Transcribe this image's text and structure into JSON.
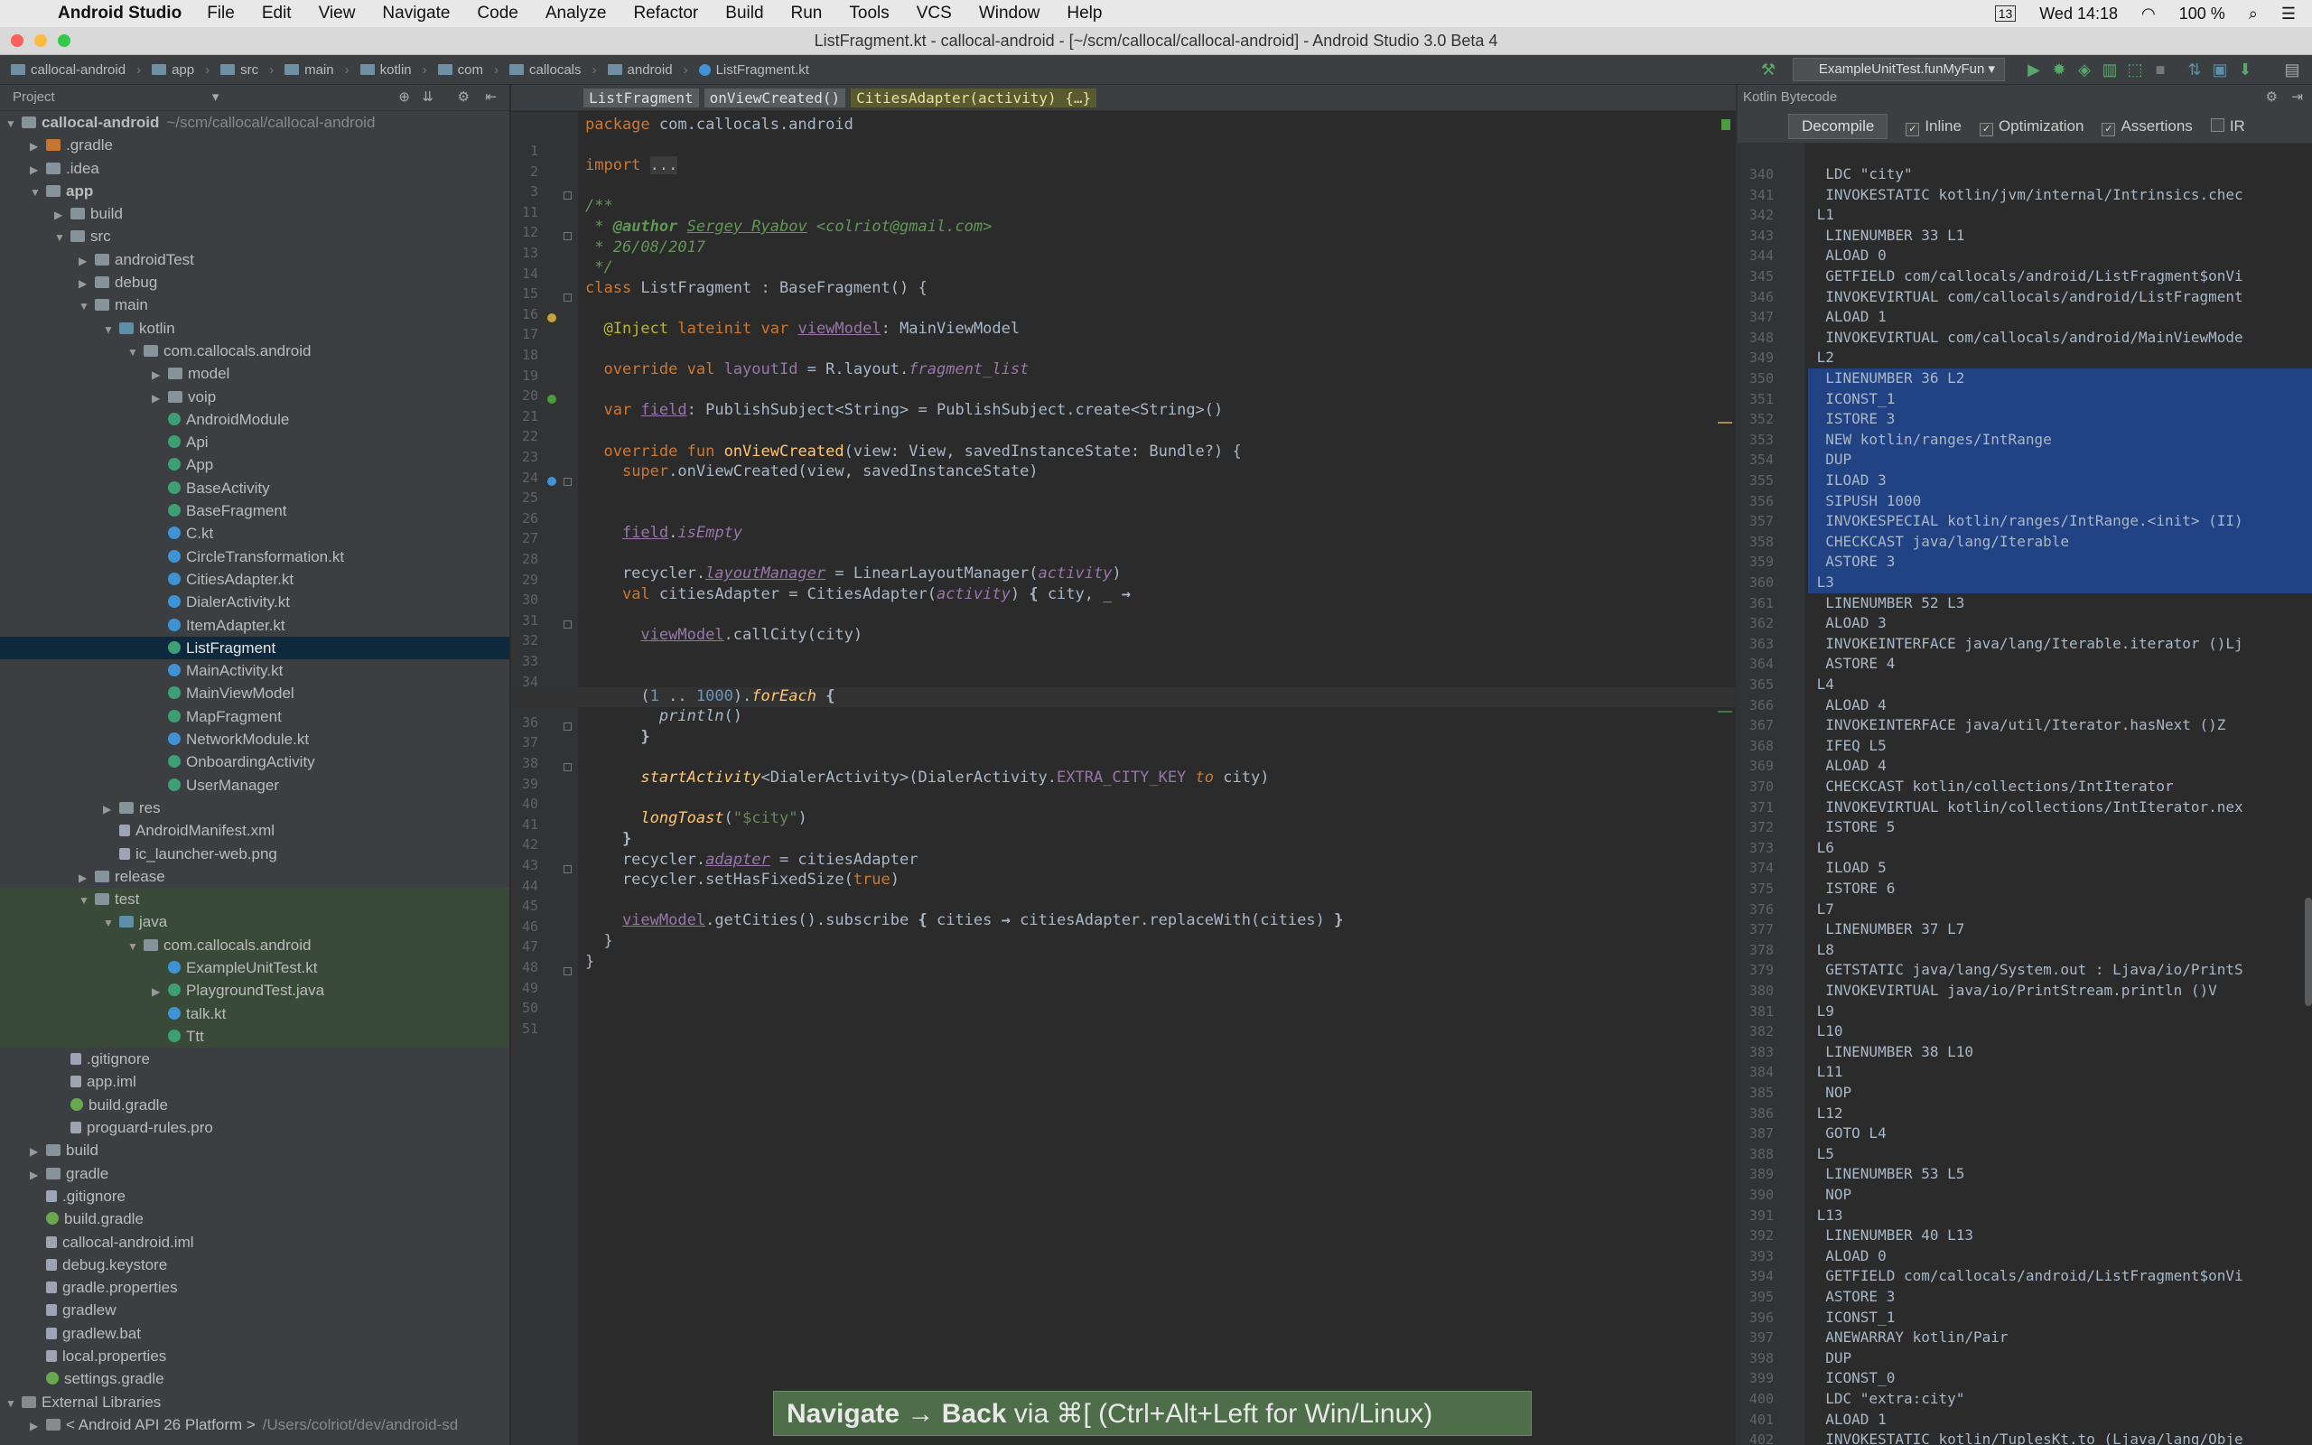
{
  "menubar": {
    "app": "Android Studio",
    "items": [
      "File",
      "Edit",
      "View",
      "Navigate",
      "Code",
      "Analyze",
      "Refactor",
      "Build",
      "Run",
      "Tools",
      "VCS",
      "Window",
      "Help"
    ],
    "status": {
      "date_time": "Wed 14:18",
      "battery": "100 %",
      "badge": "13"
    }
  },
  "window": {
    "title": "ListFragment.kt - callocal-android - [~/scm/callocal/callocal-android] - Android Studio 3.0 Beta 4"
  },
  "navbar": {
    "breadcrumbs": [
      "callocal-android",
      "app",
      "src",
      "main",
      "kotlin",
      "com",
      "callocals",
      "android",
      "ListFragment.kt"
    ],
    "run_config": "ExampleUnitTest.funMyFun"
  },
  "project": {
    "header": "Project",
    "tree": [
      {
        "label": "callocal-android",
        "suffix": "~/scm/callocal/callocal-android",
        "depth": 0,
        "open": true,
        "icon": "folder",
        "bold": true
      },
      {
        "label": ".gradle",
        "depth": 1,
        "open": false,
        "icon": "excl"
      },
      {
        "label": ".idea",
        "depth": 1,
        "open": false,
        "icon": "folder"
      },
      {
        "label": "app",
        "depth": 1,
        "open": true,
        "icon": "folder",
        "bold": true
      },
      {
        "label": "build",
        "depth": 2,
        "open": false,
        "icon": "folder"
      },
      {
        "label": "src",
        "depth": 2,
        "open": true,
        "icon": "folder"
      },
      {
        "label": "androidTest",
        "depth": 3,
        "open": false,
        "icon": "folder"
      },
      {
        "label": "debug",
        "depth": 3,
        "open": false,
        "icon": "folder"
      },
      {
        "label": "main",
        "depth": 3,
        "open": true,
        "icon": "folder"
      },
      {
        "label": "kotlin",
        "depth": 4,
        "open": true,
        "icon": "src"
      },
      {
        "label": "com.callocals.android",
        "depth": 5,
        "open": true,
        "icon": "folder"
      },
      {
        "label": "model",
        "depth": 6,
        "open": false,
        "icon": "folder"
      },
      {
        "label": "voip",
        "depth": 6,
        "open": false,
        "icon": "folder"
      },
      {
        "label": "AndroidModule",
        "depth": 6,
        "icon": "cls"
      },
      {
        "label": "Api",
        "depth": 6,
        "icon": "cls"
      },
      {
        "label": "App",
        "depth": 6,
        "icon": "cls"
      },
      {
        "label": "BaseActivity",
        "depth": 6,
        "icon": "cls"
      },
      {
        "label": "BaseFragment",
        "depth": 6,
        "icon": "cls"
      },
      {
        "label": "C.kt",
        "depth": 6,
        "icon": "kt"
      },
      {
        "label": "CircleTransformation.kt",
        "depth": 6,
        "icon": "kt"
      },
      {
        "label": "CitiesAdapter.kt",
        "depth": 6,
        "icon": "kt"
      },
      {
        "label": "DialerActivity.kt",
        "depth": 6,
        "icon": "kt"
      },
      {
        "label": "ItemAdapter.kt",
        "depth": 6,
        "icon": "kt"
      },
      {
        "label": "ListFragment",
        "depth": 6,
        "icon": "cls",
        "selected": true
      },
      {
        "label": "MainActivity.kt",
        "depth": 6,
        "icon": "kt"
      },
      {
        "label": "MainViewModel",
        "depth": 6,
        "icon": "cls"
      },
      {
        "label": "MapFragment",
        "depth": 6,
        "icon": "cls"
      },
      {
        "label": "NetworkModule.kt",
        "depth": 6,
        "icon": "kt"
      },
      {
        "label": "OnboardingActivity",
        "depth": 6,
        "icon": "cls"
      },
      {
        "label": "UserManager",
        "depth": 6,
        "icon": "cls"
      },
      {
        "label": "res",
        "depth": 4,
        "open": false,
        "icon": "folder"
      },
      {
        "label": "AndroidManifest.xml",
        "depth": 4,
        "icon": "file"
      },
      {
        "label": "ic_launcher-web.png",
        "depth": 4,
        "icon": "file"
      },
      {
        "label": "release",
        "depth": 3,
        "open": false,
        "icon": "folder"
      },
      {
        "label": "test",
        "depth": 3,
        "open": true,
        "icon": "folder",
        "green": true
      },
      {
        "label": "java",
        "depth": 4,
        "open": true,
        "icon": "src",
        "green": true
      },
      {
        "label": "com.callocals.android",
        "depth": 5,
        "open": true,
        "icon": "folder",
        "green": true
      },
      {
        "label": "ExampleUnitTest.kt",
        "depth": 6,
        "icon": "kt",
        "green": true
      },
      {
        "label": "PlaygroundTest.java",
        "depth": 6,
        "open": false,
        "icon": "cls",
        "green": true
      },
      {
        "label": "talk.kt",
        "depth": 6,
        "icon": "kt",
        "green": true
      },
      {
        "label": "Ttt",
        "depth": 6,
        "icon": "cls",
        "green": true
      },
      {
        "label": ".gitignore",
        "depth": 2,
        "icon": "file"
      },
      {
        "label": "app.iml",
        "depth": 2,
        "icon": "file"
      },
      {
        "label": "build.gradle",
        "depth": 2,
        "icon": "gradle"
      },
      {
        "label": "proguard-rules.pro",
        "depth": 2,
        "icon": "file"
      },
      {
        "label": "build",
        "depth": 1,
        "open": false,
        "icon": "folder"
      },
      {
        "label": "gradle",
        "depth": 1,
        "open": false,
        "icon": "folder"
      },
      {
        "label": ".gitignore",
        "depth": 1,
        "icon": "file"
      },
      {
        "label": "build.gradle",
        "depth": 1,
        "icon": "gradle"
      },
      {
        "label": "callocal-android.iml",
        "depth": 1,
        "icon": "file"
      },
      {
        "label": "debug.keystore",
        "depth": 1,
        "icon": "file"
      },
      {
        "label": "gradle.properties",
        "depth": 1,
        "icon": "file"
      },
      {
        "label": "gradlew",
        "depth": 1,
        "icon": "file"
      },
      {
        "label": "gradlew.bat",
        "depth": 1,
        "icon": "file"
      },
      {
        "label": "local.properties",
        "depth": 1,
        "icon": "file"
      },
      {
        "label": "settings.gradle",
        "depth": 1,
        "icon": "gradle"
      },
      {
        "label": "External Libraries",
        "depth": 0,
        "open": true,
        "icon": "lib"
      },
      {
        "label": "< Android API 26 Platform >",
        "suffix": "/Users/colriot/dev/android-sd",
        "depth": 1,
        "open": false,
        "icon": "lib"
      }
    ]
  },
  "editor": {
    "breadcrumbs": [
      "ListFragment",
      "onViewCreated()",
      "CitiesAdapter(activity) {…}"
    ],
    "lines": [
      {
        "n": "1",
        "html": "<span class=\"kw\">package</span> com.callocals.android"
      },
      {
        "n": "2",
        "html": ""
      },
      {
        "n": "3",
        "html": "<span class=\"kw\">import</span> <span style=\"background:#3b3b3b\">...</span>"
      },
      {
        "n": "11",
        "html": ""
      },
      {
        "n": "12",
        "html": "<span class=\"cm\">/**</span>"
      },
      {
        "n": "13",
        "html": "<span class=\"cm\"> * <b>@author</b> <u>Sergey Ryabov</u> &lt;colriot@gmail.com&gt;</span>"
      },
      {
        "n": "14",
        "html": "<span class=\"cm\"> * 26/08/2017</span>"
      },
      {
        "n": "15",
        "html": "<span class=\"cm\"> */</span>"
      },
      {
        "n": "16",
        "html": "<span class=\"kw\">class</span> ListFragment : BaseFragment() {"
      },
      {
        "n": "17",
        "html": ""
      },
      {
        "n": "18",
        "html": "  <span class=\"ann\">@Inject</span> <span class=\"kw\">lateinit var</span> <span class=\"prop ul\">viewModel</span>: MainViewModel"
      },
      {
        "n": "19",
        "html": ""
      },
      {
        "n": "20",
        "html": "  <span class=\"kw\">override val</span> <span class=\"prop\">layoutId</span> = R.layout.<span class=\"prop ital\">fragment_list</span>"
      },
      {
        "n": "21",
        "html": ""
      },
      {
        "n": "22",
        "html": "  <span class=\"kw\">var</span> <span class=\"prop ul\">field</span>: PublishSubject&lt;String&gt; = PublishSubject.create&lt;String&gt;()"
      },
      {
        "n": "23",
        "html": ""
      },
      {
        "n": "24",
        "html": "  <span class=\"kw\">override fun</span> <span class=\"fn\">onViewCreated</span>(view: View, savedInstanceState: Bundle?) {"
      },
      {
        "n": "25",
        "html": "    <span class=\"kw\">super</span>.onViewCreated(view, savedInstanceState)"
      },
      {
        "n": "26",
        "html": ""
      },
      {
        "n": "27",
        "html": ""
      },
      {
        "n": "28",
        "html": "    <span class=\"prop ul\">field</span>.<span class=\"prop ital\">isEmpty</span>"
      },
      {
        "n": "29",
        "html": ""
      },
      {
        "n": "30",
        "html": "    recycler.<span class=\"prop ital ul\">layoutManager</span> = LinearLayoutManager(<span class=\"prop ital\">activity</span>)"
      },
      {
        "n": "31",
        "html": "    <span class=\"kw\">val</span> citiesAdapter = CitiesAdapter(<span class=\"prop ital\">activity</span>) <b>{</b> city, _ <b>→</b>"
      },
      {
        "n": "32",
        "html": ""
      },
      {
        "n": "33",
        "html": "      <span class=\"prop ul\">viewModel</span>.callCity(city)"
      },
      {
        "n": "34",
        "html": ""
      },
      {
        "n": "35",
        "html": ""
      },
      {
        "n": "36",
        "html": "      (<span class=\"num\">1</span> .. <span class=\"num\">1000</span>).<span class=\"fn ital\">forEach</span> <b>{</b>"
      },
      {
        "n": "37",
        "html": "        <span class=\"ital\">println</span>()"
      },
      {
        "n": "38",
        "html": "      <b>}</b>"
      },
      {
        "n": "39",
        "html": ""
      },
      {
        "n": "40",
        "html": "      <span class=\"fn ital\">startActivity</span>&lt;DialerActivity&gt;(DialerActivity.<span class=\"prop\">EXTRA_CITY_KEY</span> <span class=\"kw ital\">to</span> city)"
      },
      {
        "n": "41",
        "html": ""
      },
      {
        "n": "42",
        "html": "      <span class=\"fn ital\">longToast</span>(<span class=\"str\">\"$city\"</span>)"
      },
      {
        "n": "43",
        "html": "    <b>}</b>"
      },
      {
        "n": "44",
        "html": "    recycler.<span class=\"prop ital ul\">adapter</span> = citiesAdapter"
      },
      {
        "n": "45",
        "html": "    recycler.setHasFixedSize(<span class=\"kw\">true</span>)"
      },
      {
        "n": "46",
        "html": ""
      },
      {
        "n": "47",
        "html": "    <span class=\"prop ul\">viewModel</span>.getCities().subscribe <b>{</b> cities <b>→</b> citiesAdapter.replaceWith(cities) <b>}</b>"
      },
      {
        "n": "48",
        "html": "  }"
      },
      {
        "n": "49",
        "html": "}"
      },
      {
        "n": "50",
        "html": ""
      },
      {
        "n": "51",
        "html": ""
      }
    ]
  },
  "bytecode": {
    "header": "Kotlin Bytecode",
    "decompile": "Decompile",
    "options": [
      {
        "label": "Inline",
        "checked": true
      },
      {
        "label": "Optimization",
        "checked": true
      },
      {
        "label": "Assertions",
        "checked": true
      },
      {
        "label": "IR",
        "checked": false
      }
    ],
    "lines": [
      {
        "n": "340",
        "t": "  LDC \"city\""
      },
      {
        "n": "341",
        "t": "  INVOKESTATIC kotlin/jvm/internal/Intrinsics.chec"
      },
      {
        "n": "342",
        "t": " L1"
      },
      {
        "n": "343",
        "t": "  LINENUMBER 33 L1"
      },
      {
        "n": "344",
        "t": "  ALOAD 0"
      },
      {
        "n": "345",
        "t": "  GETFIELD com/callocals/android/ListFragment$onVi"
      },
      {
        "n": "346",
        "t": "  INVOKEVIRTUAL com/callocals/android/ListFragment"
      },
      {
        "n": "347",
        "t": "  ALOAD 1"
      },
      {
        "n": "348",
        "t": "  INVOKEVIRTUAL com/callocals/android/MainViewMode"
      },
      {
        "n": "349",
        "t": " L2"
      },
      {
        "n": "350",
        "t": "  LINENUMBER 36 L2",
        "hl": true
      },
      {
        "n": "351",
        "t": "  ICONST_1",
        "hl": true
      },
      {
        "n": "352",
        "t": "  ISTORE 3",
        "hl": true
      },
      {
        "n": "353",
        "t": "  NEW kotlin/ranges/IntRange",
        "hl": true
      },
      {
        "n": "354",
        "t": "  DUP",
        "hl": true
      },
      {
        "n": "355",
        "t": "  ILOAD 3",
        "hl": true
      },
      {
        "n": "356",
        "t": "  SIPUSH 1000",
        "hl": true
      },
      {
        "n": "357",
        "t": "  INVOKESPECIAL kotlin/ranges/IntRange.<init> (II)",
        "hl": true
      },
      {
        "n": "358",
        "t": "  CHECKCAST java/lang/Iterable",
        "hl": true
      },
      {
        "n": "359",
        "t": "  ASTORE 3",
        "hl": true
      },
      {
        "n": "360",
        "t": " L3",
        "hl": true
      },
      {
        "n": "361",
        "t": "  LINENUMBER 52 L3"
      },
      {
        "n": "362",
        "t": "  ALOAD 3"
      },
      {
        "n": "363",
        "t": "  INVOKEINTERFACE java/lang/Iterable.iterator ()Lj"
      },
      {
        "n": "364",
        "t": "  ASTORE 4"
      },
      {
        "n": "365",
        "t": " L4"
      },
      {
        "n": "366",
        "t": "  ALOAD 4"
      },
      {
        "n": "367",
        "t": "  INVOKEINTERFACE java/util/Iterator.hasNext ()Z"
      },
      {
        "n": "368",
        "t": "  IFEQ L5"
      },
      {
        "n": "369",
        "t": "  ALOAD 4"
      },
      {
        "n": "370",
        "t": "  CHECKCAST kotlin/collections/IntIterator"
      },
      {
        "n": "371",
        "t": "  INVOKEVIRTUAL kotlin/collections/IntIterator.nex"
      },
      {
        "n": "372",
        "t": "  ISTORE 5"
      },
      {
        "n": "373",
        "t": " L6"
      },
      {
        "n": "374",
        "t": "  ILOAD 5"
      },
      {
        "n": "375",
        "t": "  ISTORE 6"
      },
      {
        "n": "376",
        "t": " L7"
      },
      {
        "n": "377",
        "t": "  LINENUMBER 37 L7"
      },
      {
        "n": "378",
        "t": " L8"
      },
      {
        "n": "379",
        "t": "  GETSTATIC java/lang/System.out : Ljava/io/PrintS"
      },
      {
        "n": "380",
        "t": "  INVOKEVIRTUAL java/io/PrintStream.println ()V"
      },
      {
        "n": "381",
        "t": " L9"
      },
      {
        "n": "382",
        "t": " L10"
      },
      {
        "n": "383",
        "t": "  LINENUMBER 38 L10"
      },
      {
        "n": "384",
        "t": " L11"
      },
      {
        "n": "385",
        "t": "  NOP"
      },
      {
        "n": "386",
        "t": " L12"
      },
      {
        "n": "387",
        "t": "  GOTO L4"
      },
      {
        "n": "388",
        "t": " L5"
      },
      {
        "n": "389",
        "t": "  LINENUMBER 53 L5"
      },
      {
        "n": "390",
        "t": "  NOP"
      },
      {
        "n": "391",
        "t": " L13"
      },
      {
        "n": "392",
        "t": "  LINENUMBER 40 L13"
      },
      {
        "n": "393",
        "t": "  ALOAD 0"
      },
      {
        "n": "394",
        "t": "  GETFIELD com/callocals/android/ListFragment$onVi"
      },
      {
        "n": "395",
        "t": "  ASTORE 3"
      },
      {
        "n": "396",
        "t": "  ICONST_1"
      },
      {
        "n": "397",
        "t": "  ANEWARRAY kotlin/Pair"
      },
      {
        "n": "398",
        "t": "  DUP"
      },
      {
        "n": "399",
        "t": "  ICONST_0"
      },
      {
        "n": "400",
        "t": "  LDC \"extra:city\""
      },
      {
        "n": "401",
        "t": "  ALOAD 1"
      },
      {
        "n": "402",
        "t": "  INVOKESTATIC kotlin/TuplesKt.to (Ljava/lang/Obje"
      }
    ]
  },
  "toast": {
    "strong1": "Navigate → Back",
    "rest": " via ⌘[ (Ctrl+Alt+Left for Win/Linux)"
  }
}
